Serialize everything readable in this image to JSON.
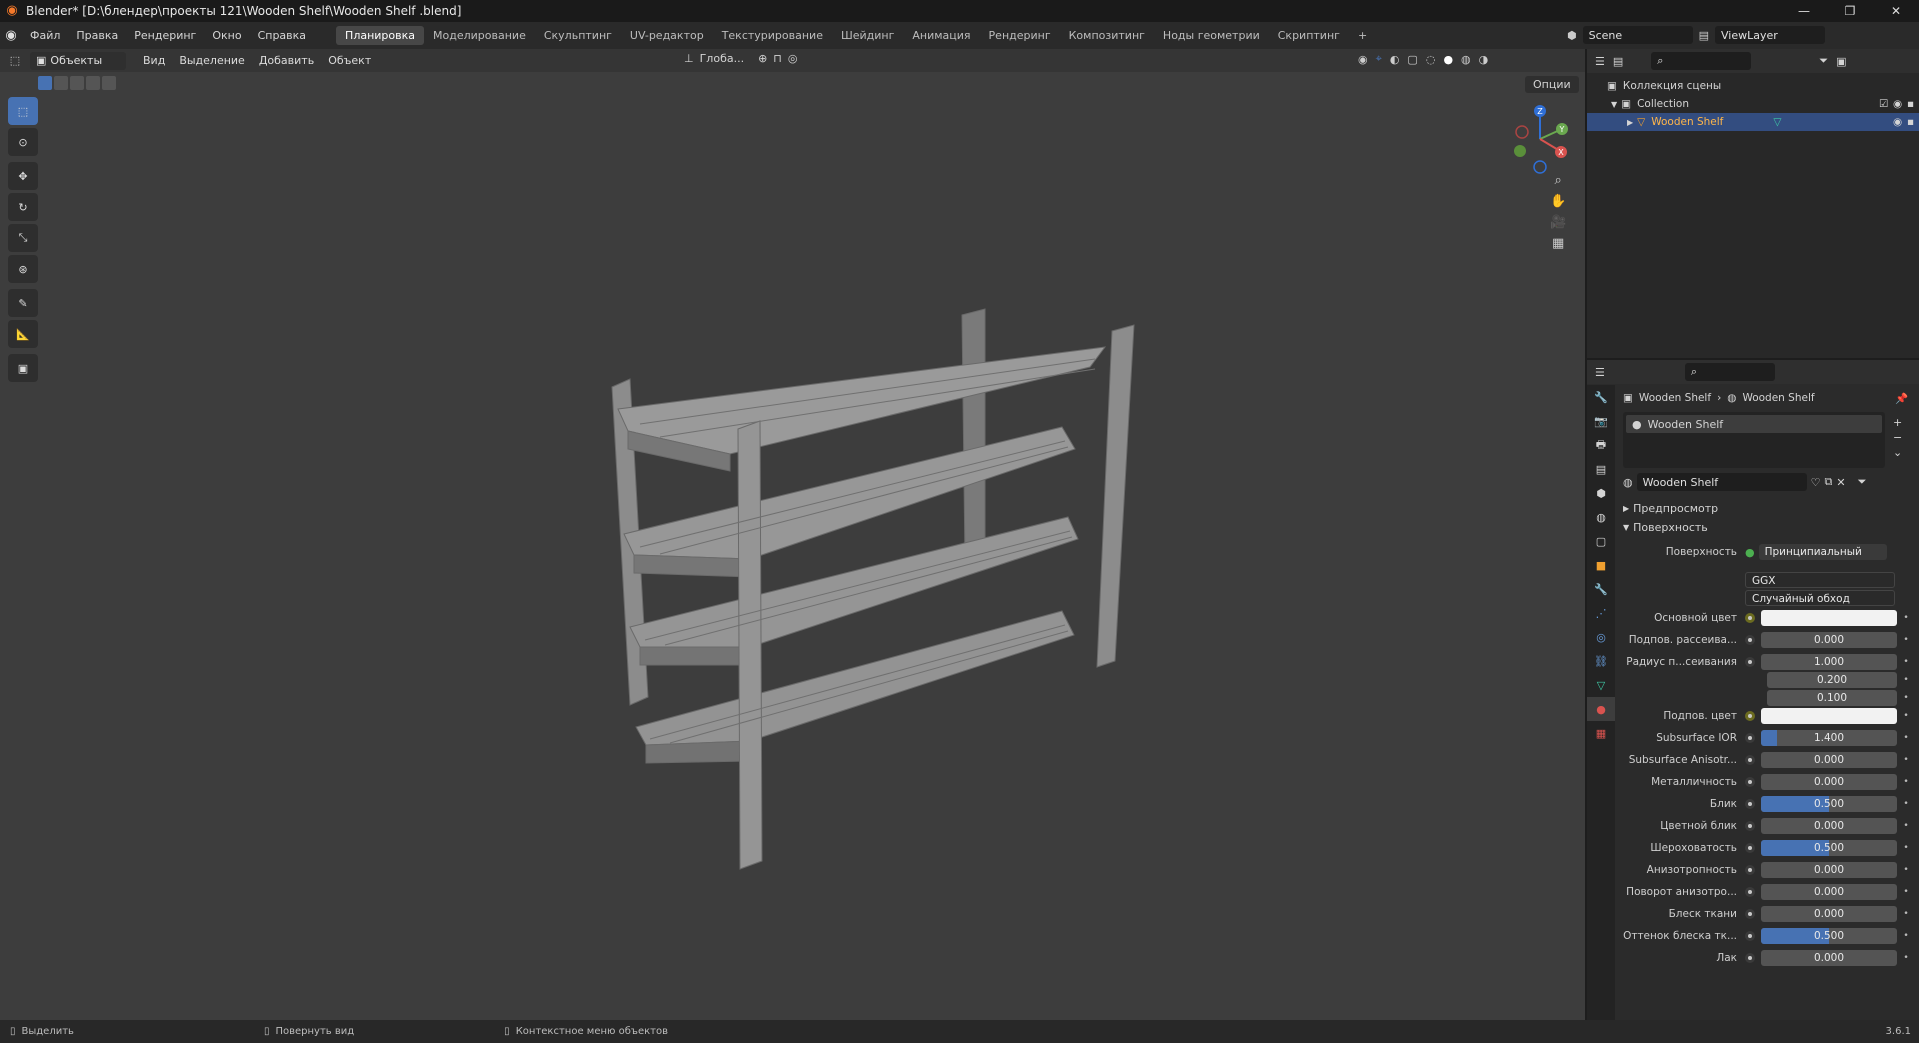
{
  "window": {
    "title": "Blender* [D:\\блендер\\проекты 121\\Wooden Shelf\\Wooden Shelf .blend]",
    "minimize": "—",
    "maximize": "❐",
    "close": "✕"
  },
  "menu": {
    "items": [
      "Файл",
      "Правка",
      "Рендеринг",
      "Окно",
      "Справка"
    ],
    "workspaces": [
      "Планировка",
      "Моделирование",
      "Скульптинг",
      "UV-редактор",
      "Текстурирование",
      "Шейдинг",
      "Анимация",
      "Рендеринг",
      "Композитинг",
      "Ноды геометрии",
      "Скриптинг"
    ],
    "active_workspace": "Планировка",
    "add_tab": "+",
    "scene": "Scene",
    "view_layer": "ViewLayer"
  },
  "viewport": {
    "mode": "Объекты",
    "menus": [
      "Вид",
      "Выделение",
      "Добавить",
      "Объект"
    ],
    "transform_orientation": "Глоба...",
    "options": "Опции",
    "gizmo_axes": {
      "x": "X",
      "y": "Y",
      "z": "Z"
    }
  },
  "outliner": {
    "scene_collection": "Коллекция сцены",
    "collection": "Collection",
    "object": "Wooden Shelf"
  },
  "properties": {
    "breadcrumb_object": "Wooden Shelf",
    "breadcrumb_material": "Wooden Shelf",
    "slot_name": "Wooden Shelf",
    "material_name": "Wooden Shelf",
    "panel_preview": "Предпросмотр",
    "panel_surface": "Поверхность",
    "surface_label": "Поверхность",
    "surface_value": "Принципиальный BSDF",
    "distribution": "GGX",
    "subsurface_method": "Случайный обход",
    "rows": [
      {
        "label": "Основной цвет",
        "type": "color",
        "value": ""
      },
      {
        "label": "Подпов. рассеива...",
        "type": "num",
        "value": "0.000",
        "fill": 0
      },
      {
        "label": "Радиус п...сеивания",
        "type": "num",
        "value": "1.000",
        "fill": 0
      },
      {
        "label": "",
        "type": "num",
        "value": "0.200",
        "fill": 0
      },
      {
        "label": "",
        "type": "num",
        "value": "0.100",
        "fill": 0
      },
      {
        "label": "Подпов. цвет",
        "type": "color",
        "value": ""
      },
      {
        "label": "Subsurface IOR",
        "type": "num",
        "value": "1.400",
        "fill": 0.12
      },
      {
        "label": "Subsurface Anisotr...",
        "type": "num",
        "value": "0.000",
        "fill": 0
      },
      {
        "label": "Металличность",
        "type": "num",
        "value": "0.000",
        "fill": 0
      },
      {
        "label": "Блик",
        "type": "num",
        "value": "0.500",
        "fill": 0.5
      },
      {
        "label": "Цветной блик",
        "type": "num",
        "value": "0.000",
        "fill": 0
      },
      {
        "label": "Шероховатость",
        "type": "num",
        "value": "0.500",
        "fill": 0.5
      },
      {
        "label": "Анизотропность",
        "type": "num",
        "value": "0.000",
        "fill": 0
      },
      {
        "label": "Поворот анизотро...",
        "type": "num",
        "value": "0.000",
        "fill": 0
      },
      {
        "label": "Блеск ткани",
        "type": "num",
        "value": "0.000",
        "fill": 0
      },
      {
        "label": "Оттенок блеска тк...",
        "type": "num",
        "value": "0.500",
        "fill": 0.5
      },
      {
        "label": "Лак",
        "type": "num",
        "value": "0.000",
        "fill": 0
      }
    ]
  },
  "status": {
    "select": "Выделить",
    "rotate_view": "Повернуть вид",
    "context_menu": "Контекстное меню объектов",
    "version": "3.6.1"
  },
  "colors": {
    "accent": "#4772b3",
    "viewport_bg": "#3d3d3d",
    "mesh": "#8a8a8a"
  }
}
